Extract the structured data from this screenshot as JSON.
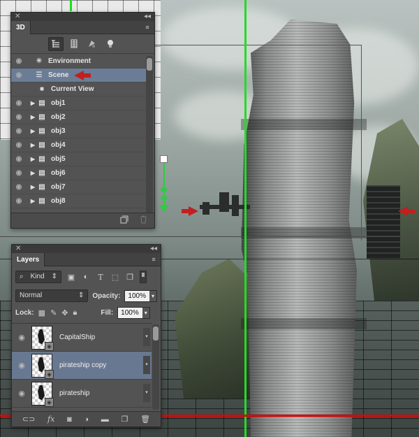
{
  "panel3d": {
    "tab_label": "3D",
    "close_glyph": "✕",
    "collapse_glyph": "◂◂",
    "menu_glyph": "≡",
    "filter_icons": [
      "scene-filter-icon",
      "mesh-filter-icon",
      "material-filter-icon",
      "light-filter-icon"
    ],
    "rows": [
      {
        "label": "Environment",
        "icon": "environment-icon",
        "expandable": false,
        "indent": 0,
        "eye": true,
        "selected": false
      },
      {
        "label": "Scene",
        "icon": "scene-icon",
        "expandable": false,
        "indent": 0,
        "eye": true,
        "selected": true
      },
      {
        "label": "Current View",
        "icon": "camera-icon",
        "expandable": false,
        "indent": 1,
        "eye": false,
        "selected": false
      },
      {
        "label": "obj1",
        "icon": "mesh-icon",
        "expandable": true,
        "indent": 1,
        "eye": true,
        "selected": false
      },
      {
        "label": "obj2",
        "icon": "mesh-icon",
        "expandable": true,
        "indent": 1,
        "eye": true,
        "selected": false
      },
      {
        "label": "obj3",
        "icon": "mesh-icon",
        "expandable": true,
        "indent": 1,
        "eye": true,
        "selected": false
      },
      {
        "label": "obj4",
        "icon": "mesh-icon",
        "expandable": true,
        "indent": 1,
        "eye": true,
        "selected": false
      },
      {
        "label": "obj5",
        "icon": "mesh-icon",
        "expandable": true,
        "indent": 1,
        "eye": true,
        "selected": false
      },
      {
        "label": "obj6",
        "icon": "mesh-icon",
        "expandable": true,
        "indent": 1,
        "eye": true,
        "selected": false
      },
      {
        "label": "obj7",
        "icon": "mesh-icon",
        "expandable": true,
        "indent": 1,
        "eye": true,
        "selected": false
      },
      {
        "label": "obj8",
        "icon": "mesh-icon",
        "expandable": true,
        "indent": 1,
        "eye": true,
        "selected": false
      }
    ]
  },
  "layers": {
    "tab_label": "Layers",
    "close_glyph": "✕",
    "collapse_glyph": "◂◂",
    "menu_glyph": "≡",
    "filter_kind": "Kind",
    "blend_mode": "Normal",
    "opacity_label": "Opacity:",
    "opacity_value": "100%",
    "lock_label": "Lock:",
    "fill_label": "Fill:",
    "fill_value": "100%",
    "items": [
      {
        "name": "CapitalShip",
        "selected": false
      },
      {
        "name": "pirateship copy",
        "selected": true
      },
      {
        "name": "pirateship",
        "selected": false
      }
    ]
  },
  "colors": {
    "panel_bg": "#535353",
    "selection": "#6b7d96",
    "annotation_arrow": "#c21f1f",
    "guide_red": "#e00000",
    "guide_green": "#22dd22"
  }
}
